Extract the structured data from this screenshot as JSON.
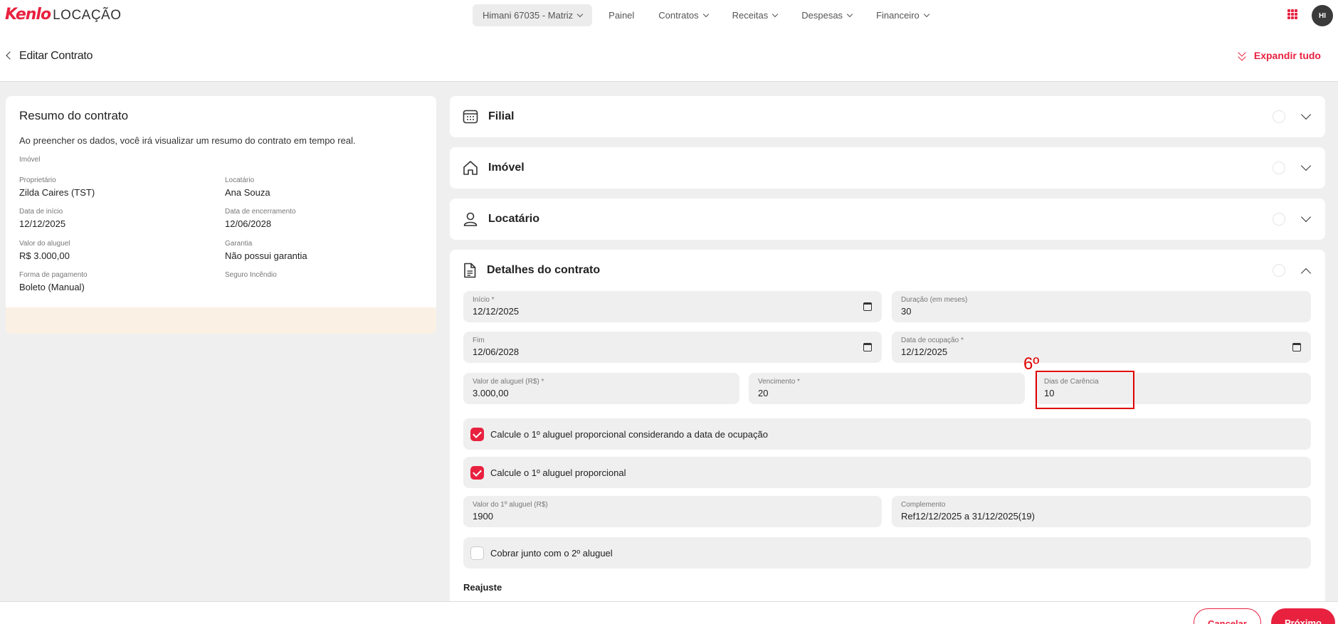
{
  "app": {
    "brand": "Kenlo",
    "product": "LOCAÇÃO",
    "avatar_initials": "HI",
    "accent_color": "#e8213f"
  },
  "nav": {
    "branch": "Himani 67035 - Matriz",
    "items": [
      "Painel",
      "Contratos",
      "Receitas",
      "Despesas",
      "Financeiro"
    ]
  },
  "header": {
    "title": "Editar Contrato",
    "expand_all": "Expandir tudo"
  },
  "summary": {
    "title": "Resumo do contrato",
    "description": "Ao preencher os dados, você irá visualizar um resumo do contrato em tempo real.",
    "section": "Imóvel",
    "fields": {
      "owner_label": "Proprietário",
      "owner": "Zilda Caires (TST)",
      "tenant_label": "Locatário",
      "tenant": "Ana Souza",
      "start_label": "Data de início",
      "start": "12/12/2025",
      "end_label": "Data de encerramento",
      "end": "12/06/2028",
      "rent_label": "Valor do aluguel",
      "rent": "R$ 3.000,00",
      "guarantee_label": "Garantia",
      "guarantee": "Não possui garantia",
      "payment_label": "Forma de pagamento",
      "payment": "Boleto (Manual)",
      "insurance_label": "Seguro Incêndio"
    }
  },
  "sections": {
    "filial": "Filial",
    "imovel": "Imóvel",
    "locatario": "Locatário",
    "detalhes": "Detalhes do contrato"
  },
  "form": {
    "inicio_label": "Início *",
    "inicio": "12/12/2025",
    "duracao_label": "Duração (em meses)",
    "duracao": "30",
    "fim_label": "Fim",
    "fim": "12/06/2028",
    "ocupacao_label": "Data de ocupação *",
    "ocupacao": "12/12/2025",
    "valor_label": "Valor de aluguel (R$) *",
    "valor": "3.000,00",
    "vencimento_label": "Vencimento *",
    "vencimento": "20",
    "carencia_label": "Dias de Carência",
    "carencia": "10",
    "check1": "Calcule o 1º aluguel proporcional considerando a data de ocupação",
    "check2": "Calcule o 1º aluguel proporcional",
    "valor1_label": "Valor do 1º aluguel (R$)",
    "valor1": "1900",
    "complemento_label": "Complemento",
    "complemento": "Ref12/12/2025 a 31/12/2025(19)",
    "check3": "Cobrar junto com o 2º aluguel",
    "reajuste": "Reajuste"
  },
  "annotation": {
    "step": "6º"
  },
  "footer": {
    "cancel": "Cancelar",
    "next": "Próximo"
  }
}
